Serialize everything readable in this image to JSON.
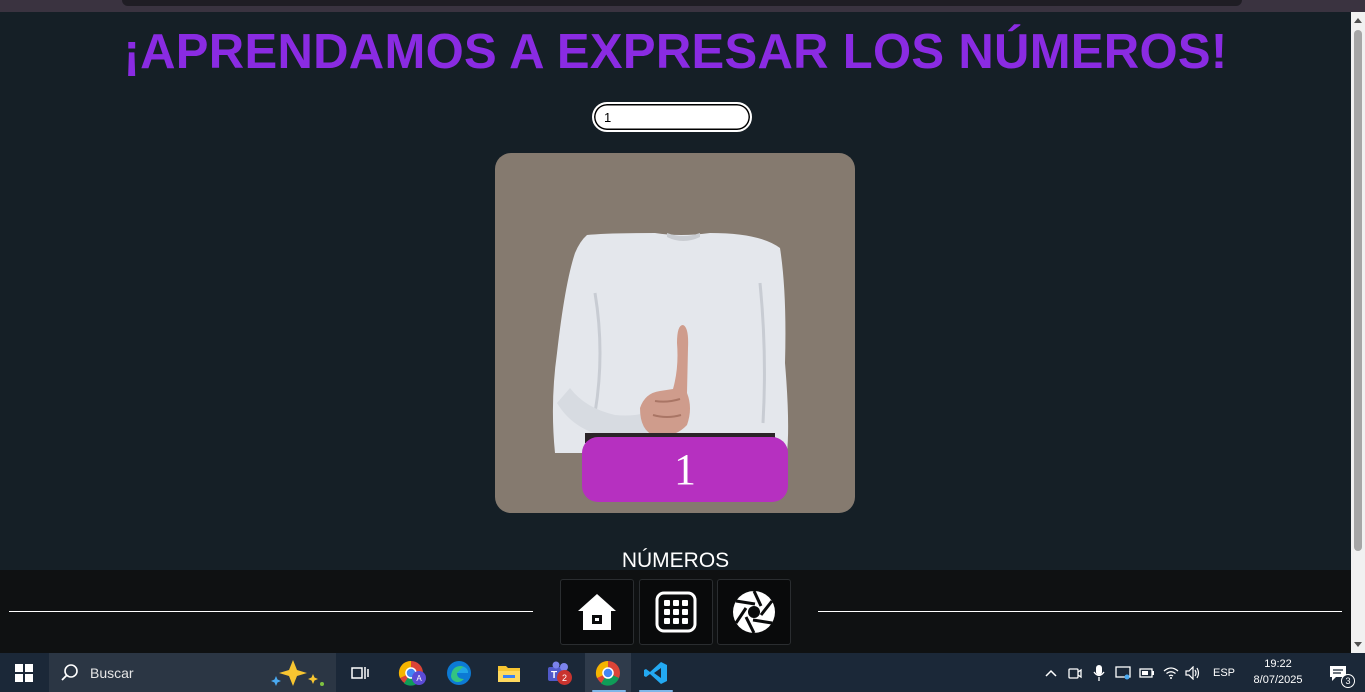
{
  "page": {
    "title": "¡APRENDAMOS A EXPRESAR LOS NÚMEROS!",
    "number_input_value": "1",
    "card_number": "1",
    "section_label": "NÚMEROS",
    "accent_title_color": "#8a2be2",
    "badge_color": "#b630c0"
  },
  "bottom_nav": {
    "buttons": [
      {
        "icon": "home-icon"
      },
      {
        "icon": "grid-icon"
      },
      {
        "icon": "camera-aperture-icon"
      }
    ]
  },
  "taskbar": {
    "search_placeholder": "Buscar",
    "teams_badge": "2",
    "chrome_profile_letter": "A",
    "language": "ESP",
    "time": "19:22",
    "date": "8/07/2025",
    "notification_count": "3"
  }
}
